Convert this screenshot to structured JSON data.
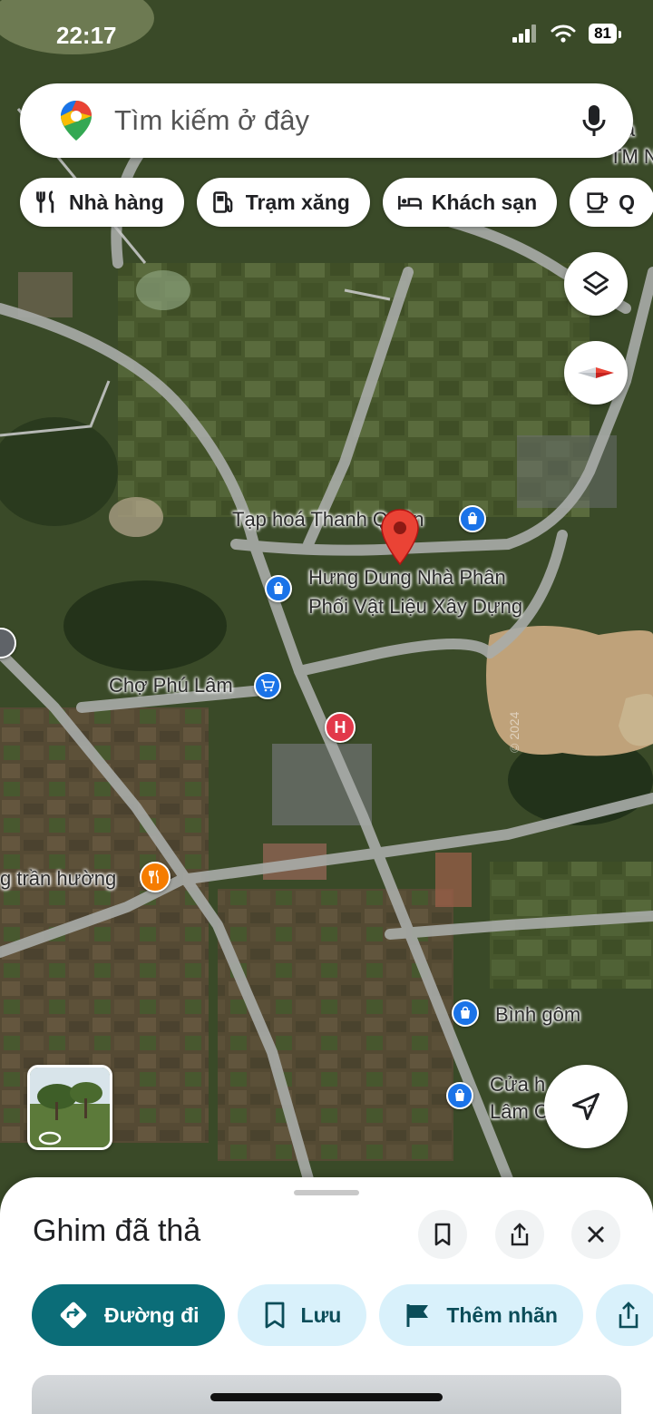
{
  "status_bar": {
    "time": "22:17",
    "battery": "81"
  },
  "search": {
    "placeholder": "Tìm kiếm ở đây"
  },
  "edge_labels": {
    "top_right_line1": "Cá",
    "top_right_line2": "TM N"
  },
  "chips": [
    {
      "label": "Nhà hàng",
      "icon": "restaurant-icon"
    },
    {
      "label": "Trạm xăng",
      "icon": "gas-station-icon"
    },
    {
      "label": "Khách sạn",
      "icon": "hotel-icon"
    },
    {
      "label": "Q",
      "icon": "coffee-icon"
    }
  ],
  "map": {
    "pois": [
      {
        "name": "Tạp hoá Thanh Q",
        "suffix": "yên",
        "icon": "shopping-bag-icon",
        "color": "#1a73e8"
      },
      {
        "name_line1": "Hưng Dung Nhà Phân",
        "name_line2": "Phối Vật Liệu Xây Dựng",
        "icon": "shopping-bag-icon",
        "color": "#1a73e8"
      },
      {
        "name": "Chợ Phú Lâm",
        "icon": "shopping-cart-icon",
        "color": "#1a73e8"
      },
      {
        "name": "H",
        "icon": "hospital-icon",
        "color": "#e2384a"
      },
      {
        "name": "g trần hường",
        "icon": "restaurant-icon",
        "color": "#f57c00"
      },
      {
        "name": "Bình gôm",
        "icon": "shopping-bag-icon",
        "color": "#1a73e8"
      },
      {
        "name_line1": "Cửa h",
        "name_line1_end": "a",
        "name_line2": "Lâm C",
        "icon": "shopping-bag-icon",
        "color": "#1a73e8"
      }
    ],
    "dropped_pin_color": "#ea4335",
    "watermark": "© 2024"
  },
  "sheet": {
    "title": "Ghim đã thả",
    "actions": [
      {
        "label": "Đường đi",
        "icon": "directions-icon"
      },
      {
        "label": "Lưu",
        "icon": "bookmark-icon"
      },
      {
        "label": "Thêm nhãn",
        "icon": "flag-icon"
      }
    ]
  },
  "colors": {
    "primary_action": "#0b6d78",
    "secondary_action": "#d9f1fb",
    "pin_red": "#ea4335"
  }
}
